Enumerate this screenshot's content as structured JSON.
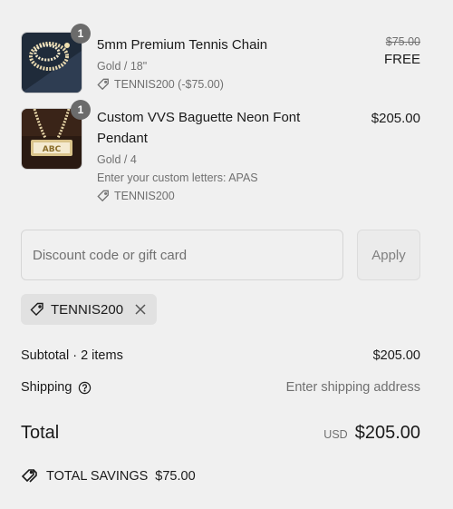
{
  "items": [
    {
      "name": "5mm Premium Tennis Chain",
      "variant": "Gold / 18\"",
      "discount": "TENNIS200 (-$75.00)",
      "quantity": "1",
      "original_price": "$75.00",
      "price": "FREE"
    },
    {
      "name": "Custom VVS Baguette Neon Font Pendant",
      "variant": "Gold / 4",
      "property": "Enter your custom letters: APAS",
      "discount": "TENNIS200",
      "quantity": "1",
      "price": "$205.00"
    }
  ],
  "discount_form": {
    "placeholder": "Discount code or gift card",
    "apply_label": "Apply"
  },
  "applied_code": "TENNIS200",
  "summary": {
    "subtotal_label": "Subtotal · 2 items",
    "subtotal_value": "$205.00",
    "shipping_label": "Shipping",
    "shipping_value": "Enter shipping address",
    "total_label": "Total",
    "currency": "USD",
    "total_value": "$205.00",
    "savings_label": "TOTAL SAVINGS",
    "savings_value": "$75.00"
  },
  "icons": {
    "tag": "tag-icon",
    "help": "question-circle-icon",
    "remove": "close-icon",
    "savings": "tags-icon"
  },
  "colors": {
    "background": "#f0f0f0",
    "badge": "#6b6b6b",
    "muted_text": "#707070"
  }
}
